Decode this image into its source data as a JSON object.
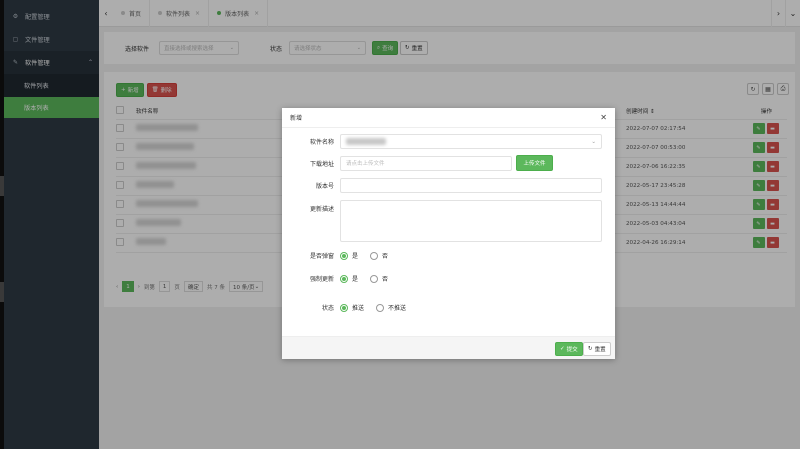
{
  "sidebar": {
    "items": [
      {
        "label": "配置管理",
        "icon": "gear-icon"
      },
      {
        "label": "文件管理",
        "icon": "file-icon"
      },
      {
        "label": "软件管理",
        "icon": "edit-icon"
      }
    ],
    "sub": [
      {
        "label": "软件列表"
      },
      {
        "label": "版本列表"
      }
    ]
  },
  "tabs": [
    {
      "label": "首页"
    },
    {
      "label": "软件列表"
    },
    {
      "label": "版本列表"
    }
  ],
  "search": {
    "software_label": "选择软件",
    "software_placeholder": "直接选择或搜索选择",
    "status_label": "状态",
    "status_placeholder": "请选择状态",
    "query_btn": "查询",
    "reset_btn": "重置"
  },
  "toolbar": {
    "add": "新增",
    "delete": "删除"
  },
  "table": {
    "headers": {
      "name": "软件名称",
      "created": "创建时间",
      "ops": "操作"
    },
    "rows": [
      {
        "created": "2022-07-07 02:17:54"
      },
      {
        "created": "2022-07-07 00:53:00"
      },
      {
        "created": "2022-07-06 16:22:35"
      },
      {
        "created": "2022-05-17 23:45:28"
      },
      {
        "created": "2022-05-13 14:44:44"
      },
      {
        "created": "2022-05-03 04:43:04"
      },
      {
        "created": "2022-04-26 16:29:14"
      }
    ]
  },
  "pager": {
    "current": "1",
    "goto": "到第",
    "page_input": "1",
    "page_unit": "页",
    "confirm": "确定",
    "total": "共 7 条",
    "size": "10 条/页"
  },
  "modal": {
    "title": "新增",
    "fields": {
      "name": "软件名称",
      "download": "下载地址",
      "download_placeholder": "请点击上传文件",
      "upload_btn": "上传文件",
      "version": "版本号",
      "desc": "更新描述",
      "popup": "是否弹窗",
      "force": "强制更新",
      "status": "状态"
    },
    "options": {
      "yes": "是",
      "no": "否",
      "push": "推送",
      "nopush": "不推送"
    },
    "submit": "提交",
    "reset": "重置"
  }
}
